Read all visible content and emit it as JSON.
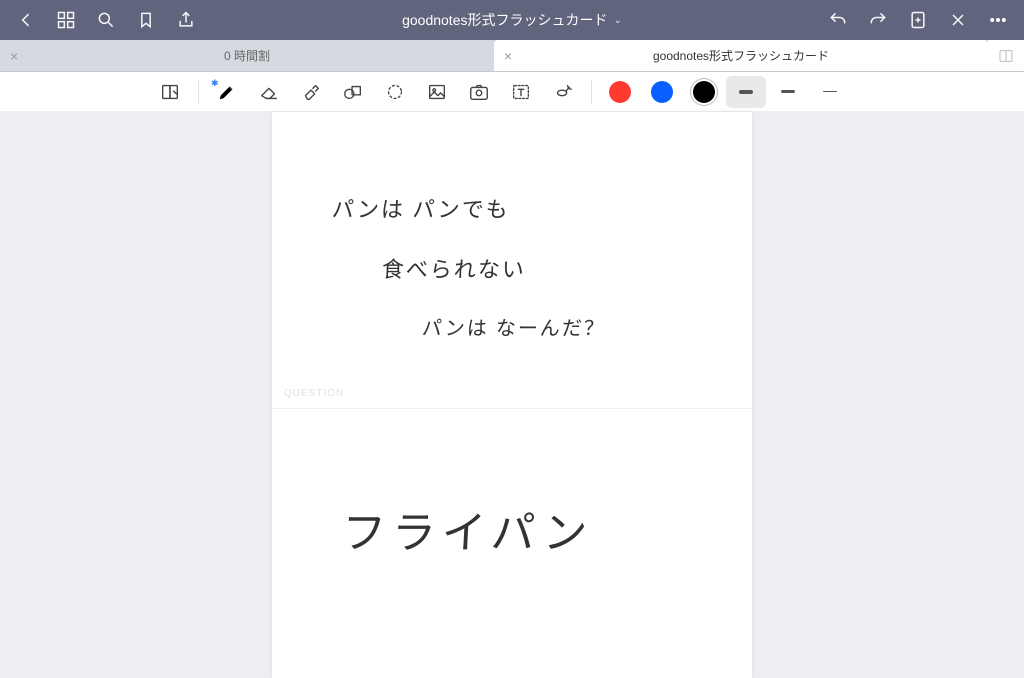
{
  "titlebar": {
    "title": "goodnotes形式フラッシュカード"
  },
  "tabs": {
    "inactive_label": "0 時間割",
    "active_label": "goodnotes形式フラッシュカード"
  },
  "tools": {
    "pen_bluetooth_indicator": "✱"
  },
  "colors": {
    "red": "#ff3b30",
    "blue": "#0a60ff",
    "black": "#000000"
  },
  "card": {
    "question_label": "QUESTION",
    "question_line1": "パンは パンでも",
    "question_line2": "食べられない",
    "question_line3": "パンは なーんだ？",
    "answer": "フライパン"
  }
}
